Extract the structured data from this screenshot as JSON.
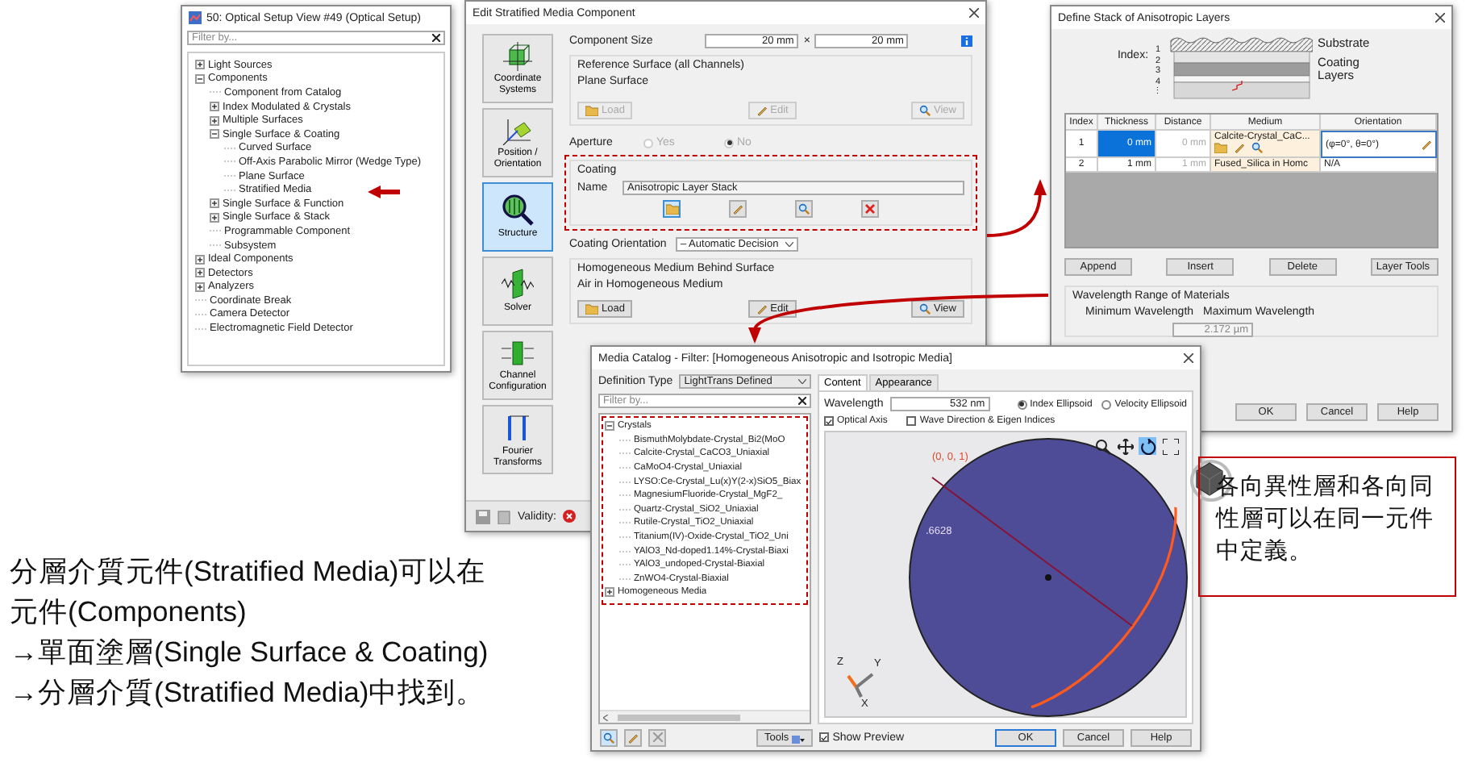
{
  "tree_window": {
    "title": "50: Optical Setup View #49 (Optical Setup)",
    "filter": {
      "placeholder": "Filter by..."
    },
    "items": [
      {
        "label": "Light Sources",
        "kind": "folder",
        "expanded": false
      },
      {
        "label": "Components",
        "kind": "folder",
        "expanded": true,
        "children": [
          {
            "label": "Component from Catalog",
            "kind": "leaf"
          },
          {
            "label": "Index Modulated & Crystals",
            "kind": "folder",
            "expanded": false
          },
          {
            "label": "Multiple Surfaces",
            "kind": "folder",
            "expanded": false
          },
          {
            "label": "Single Surface & Coating",
            "kind": "folder",
            "expanded": true,
            "children": [
              {
                "label": "Curved Surface",
                "kind": "leaf"
              },
              {
                "label": "Off-Axis Parabolic Mirror (Wedge Type)",
                "kind": "leaf"
              },
              {
                "label": "Plane Surface",
                "kind": "leaf"
              },
              {
                "label": "Stratified Media",
                "kind": "leaf"
              }
            ]
          },
          {
            "label": "Single Surface & Function",
            "kind": "folder",
            "expanded": false
          },
          {
            "label": "Single Surface & Stack",
            "kind": "folder",
            "expanded": false
          },
          {
            "label": "Programmable Component",
            "kind": "leaf"
          },
          {
            "label": "Subsystem",
            "kind": "leaf"
          }
        ]
      },
      {
        "label": "Ideal Components",
        "kind": "folder",
        "expanded": false
      },
      {
        "label": "Detectors",
        "kind": "folder",
        "expanded": false
      },
      {
        "label": "Analyzers",
        "kind": "folder",
        "expanded": false
      },
      {
        "label": "Coordinate Break",
        "kind": "leaf"
      },
      {
        "label": "Camera Detector",
        "kind": "leaf"
      },
      {
        "label": "Electromagnetic Field Detector",
        "kind": "leaf"
      }
    ]
  },
  "stratified_dialog": {
    "title": "Edit Stratified Media Component",
    "side_tabs": [
      {
        "label": "Coordinate Systems",
        "kind": "coordinates",
        "selected": false
      },
      {
        "label": "Position / Orientation",
        "kind": "position",
        "selected": false
      },
      {
        "label": "Structure",
        "kind": "structure",
        "selected": true
      },
      {
        "label": "Solver",
        "kind": "solver",
        "selected": false
      },
      {
        "label": "Channel Configuration",
        "kind": "channel",
        "selected": false
      },
      {
        "label": "Fourier Transforms",
        "kind": "fourier",
        "selected": false
      }
    ],
    "component_size": {
      "label": "Component Size",
      "width": "20 mm",
      "separator": "×",
      "height": "20 mm"
    },
    "reference_surface": {
      "title": "Reference Surface (all Channels)",
      "value": "Plane Surface",
      "buttons": [
        {
          "label": "Load",
          "kind": "load",
          "disabled": true
        },
        {
          "label": "Edit",
          "kind": "edit",
          "disabled": true
        },
        {
          "label": "View",
          "kind": "view",
          "disabled": true
        }
      ]
    },
    "aperture": {
      "label": "Aperture",
      "disabled": true,
      "options": [
        {
          "label": "Yes",
          "selected": false
        },
        {
          "label": "No",
          "selected": true
        }
      ]
    },
    "coating": {
      "title": "Coating",
      "name_label": "Name",
      "name": "Anisotropic Layer Stack",
      "highlighted": true
    },
    "coating_orientation": {
      "label": "Coating Orientation",
      "value": "– Automatic Decision"
    },
    "medium_behind": {
      "title": "Homogeneous Medium Behind Surface",
      "value": "Air in Homogeneous Medium",
      "buttons": [
        {
          "label": "Load",
          "kind": "load",
          "disabled": false
        },
        {
          "label": "Edit",
          "kind": "edit",
          "disabled": false
        },
        {
          "label": "View",
          "kind": "view",
          "disabled": false
        }
      ]
    },
    "status_bar": {
      "validity_label": "Validity:",
      "valid": false
    }
  },
  "stack_dialog": {
    "title": "Define Stack of Anisotropic Layers",
    "diagram": {
      "index_label": "Index:",
      "indices": [
        "1",
        "2",
        "3",
        "4",
        "⋮"
      ],
      "substrate_label": "Substrate",
      "coating_label": "Coating Layers"
    },
    "table": {
      "columns": [
        "Index",
        "Thickness",
        "Distance",
        "Medium",
        "Orientation"
      ],
      "rows": [
        {
          "index": "1",
          "thickness": "0 mm",
          "distance": "0 mm",
          "medium": "Calcite-Crystal_CaC...",
          "orientation": "(φ=0°, θ=0°)",
          "selected": true
        },
        {
          "index": "2",
          "thickness": "1 mm",
          "distance": "1 mm",
          "medium": "Fused_Silica in Homc",
          "orientation": "N/A",
          "selected": false
        }
      ]
    },
    "buttons": [
      {
        "label": "Append",
        "kind": "plain"
      },
      {
        "label": "Insert",
        "kind": "plain"
      },
      {
        "label": "Delete",
        "kind": "plain"
      },
      {
        "label": "Layer Tools",
        "kind": "menu"
      }
    ],
    "wavelength_group": {
      "title": "Wavelength Range of Materials",
      "min_label": "Minimum Wavelength",
      "max_label": "Maximum Wavelength",
      "max_value": "2.172 µm"
    },
    "footer_buttons": [
      "OK",
      "Cancel",
      "Help"
    ]
  },
  "media_catalog": {
    "title": "Media Catalog - Filter: [Homogeneous Anisotropic and Isotropic Media]",
    "definition_type": {
      "label": "Definition Type",
      "value": "LightTrans Defined"
    },
    "filter": {
      "placeholder": "Filter by..."
    },
    "tree": [
      {
        "label": "Crystals",
        "kind": "folder",
        "expanded": true,
        "children": [
          {
            "label": "BismuthMolybdate-Crystal_Bi2(MoO",
            "kind": "leaf"
          },
          {
            "label": "Calcite-Crystal_CaCO3_Uniaxial",
            "kind": "leaf"
          },
          {
            "label": "CaMoO4-Crystal_Uniaxial",
            "kind": "leaf"
          },
          {
            "label": "LYSO:Ce-Crystal_Lu(x)Y(2-x)SiO5_Biax",
            "kind": "leaf"
          },
          {
            "label": "MagnesiumFluoride-Crystal_MgF2_",
            "kind": "leaf"
          },
          {
            "label": "Quartz-Crystal_SiO2_Uniaxial",
            "kind": "leaf"
          },
          {
            "label": "Rutile-Crystal_TiO2_Uniaxial",
            "kind": "leaf"
          },
          {
            "label": "Titanium(IV)-Oxide-Crystal_TiO2_Uni",
            "kind": "leaf"
          },
          {
            "label": "YAlO3_Nd-doped1.14%-Crystal-Biaxi",
            "kind": "leaf"
          },
          {
            "label": "YAlO3_undoped-Crystal-Biaxial",
            "kind": "leaf"
          },
          {
            "label": "ZnWO4-Crystal-Biaxial",
            "kind": "leaf"
          }
        ]
      },
      {
        "label": "Homogeneous Media",
        "kind": "folder",
        "expanded": false
      }
    ],
    "tabs": [
      {
        "label": "Content",
        "selected": true
      },
      {
        "label": "Appearance",
        "selected": false
      }
    ],
    "wavelength": {
      "label": "Wavelength",
      "value": "532 nm"
    },
    "display_mode": [
      {
        "label": "Index Ellipsoid",
        "selected": true
      },
      {
        "label": "Velocity Ellipsoid",
        "selected": false
      }
    ],
    "options": [
      {
        "label": "Optical Axis",
        "checked": true
      },
      {
        "label": "Wave Direction & Eigen Indices",
        "checked": false
      }
    ],
    "viewer": {
      "axis_point_label": "(0, 0, 1)",
      "value_label": ".6628",
      "axes": [
        "Z",
        "Y",
        "X"
      ]
    },
    "tools_label": "Tools",
    "show_preview": {
      "label": "Show Preview",
      "checked": true
    },
    "footer_buttons": [
      "OK",
      "Cancel",
      "Help"
    ]
  },
  "caption": {
    "lines": [
      "分層介質元件(Stratified Media)可以在",
      "元件(Components)",
      "→單面塗層(Single Surface & Coating)",
      "→分層介質(Stratified Media)中找到。"
    ]
  },
  "note": {
    "text": "各向異性層和各向同性層可以在同一元件中定義。"
  }
}
